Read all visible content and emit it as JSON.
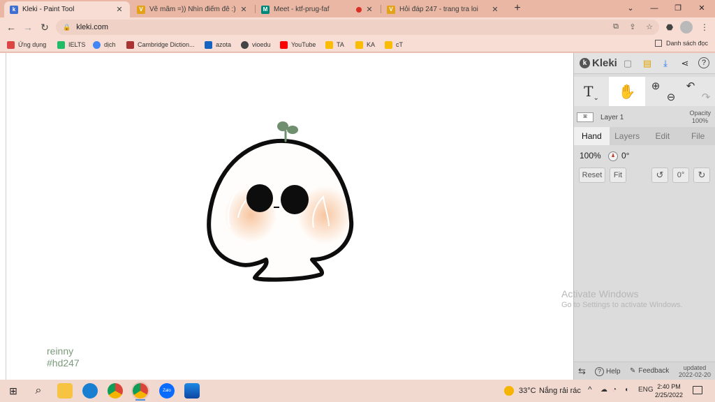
{
  "browser": {
    "tabs": [
      {
        "title": "Kleki - Paint Tool",
        "favicon_color": "#3f6fd1",
        "favicon_glyph": "k",
        "active": true
      },
      {
        "title": "Vẽ mãm =)) Nhìn điểm đê :) câu",
        "favicon_color": "#e3a21a",
        "favicon_glyph": "V",
        "active": false
      },
      {
        "title": "Meet - ktf-prug-faf",
        "favicon_color": "#00897b",
        "favicon_glyph": "M",
        "active": false,
        "recording": true
      },
      {
        "title": "Hỏi đáp 247 - trang tra loi",
        "favicon_color": "#e3a21a",
        "favicon_glyph": "V",
        "active": false
      }
    ],
    "new_tab_glyph": "+",
    "window_buttons": {
      "dropdown": "⌄",
      "minimize": "—",
      "restore": "❐",
      "close": "✕"
    },
    "nav": {
      "back": "←",
      "forward": "→",
      "reload": "↻"
    },
    "url": "kleki.com",
    "lock_glyph": "🔒",
    "omnibox_icons": {
      "translate": "⧉",
      "share": "⇪",
      "star": "☆"
    },
    "toolbar_icons": {
      "extensions": "⬣",
      "menu": "⋮"
    },
    "bookmarks": [
      {
        "label": "Ứng dụng",
        "color": "#d44"
      },
      {
        "label": "IELTS",
        "color": "#2b6"
      },
      {
        "label": "dịch",
        "color": "#4285f4"
      },
      {
        "label": "Cambridge Diction...",
        "color": "#a33"
      },
      {
        "label": "azota",
        "color": "#1565c0"
      },
      {
        "label": "vioedu",
        "color": "#444"
      },
      {
        "label": "YouTube",
        "color": "#f00"
      },
      {
        "label": "TA",
        "color": "#fbbc04"
      },
      {
        "label": "KA",
        "color": "#fbbc04"
      },
      {
        "label": "cT",
        "color": "#fbbc04"
      }
    ],
    "reading_list": "Danh sách đọc"
  },
  "kleki": {
    "logo": "Kleki",
    "header_icons": {
      "new": "▢",
      "open": "▤",
      "save": "⤓",
      "share": "⋖",
      "help": "?"
    },
    "tools": {
      "text": "T",
      "hand": "✋",
      "zoom_in": "⊕",
      "zoom_out": "⊖",
      "undo": "↶",
      "redo": "↷"
    },
    "layer": {
      "name": "Layer 1",
      "thumb": "ꕤ",
      "opacity_label": "Opacity",
      "opacity_value": "100%"
    },
    "tabs": [
      "Hand",
      "Layers",
      "Edit",
      "File"
    ],
    "active_tab": "Hand",
    "zoom": "100%",
    "angle": "0°",
    "buttons": {
      "reset": "Reset",
      "fit": "Fit",
      "rotate_left": "↺",
      "angle_zero": "0°",
      "rotate_right": "↻"
    },
    "footer": {
      "swap": "⇆",
      "help": "Help",
      "feedback": "Feedback",
      "updated_label": "updated",
      "updated_date": "2022-02-20"
    },
    "signature": [
      "reinny",
      "#hd247"
    ]
  },
  "watermark": {
    "line1": "Activate Windows",
    "line2": "Go to Settings to activate Windows."
  },
  "taskbar": {
    "start": "⊞",
    "search": "⌕",
    "weather_temp": "33°C",
    "weather_desc": "Nắng rải rác",
    "tray": {
      "chevron": "^",
      "network": "◔",
      "volume": "◖",
      "lang": "ENG"
    },
    "time": "2:40 PM",
    "date": "2/25/2022"
  },
  "colors": {
    "tab_strip": "#e9b7a4",
    "chrome_bg": "#f7ddd3",
    "outline": "#0d0d0d",
    "blush": "#f6c8a6",
    "sprout": "#6f8f6f",
    "signature": "#7b9a7b"
  }
}
